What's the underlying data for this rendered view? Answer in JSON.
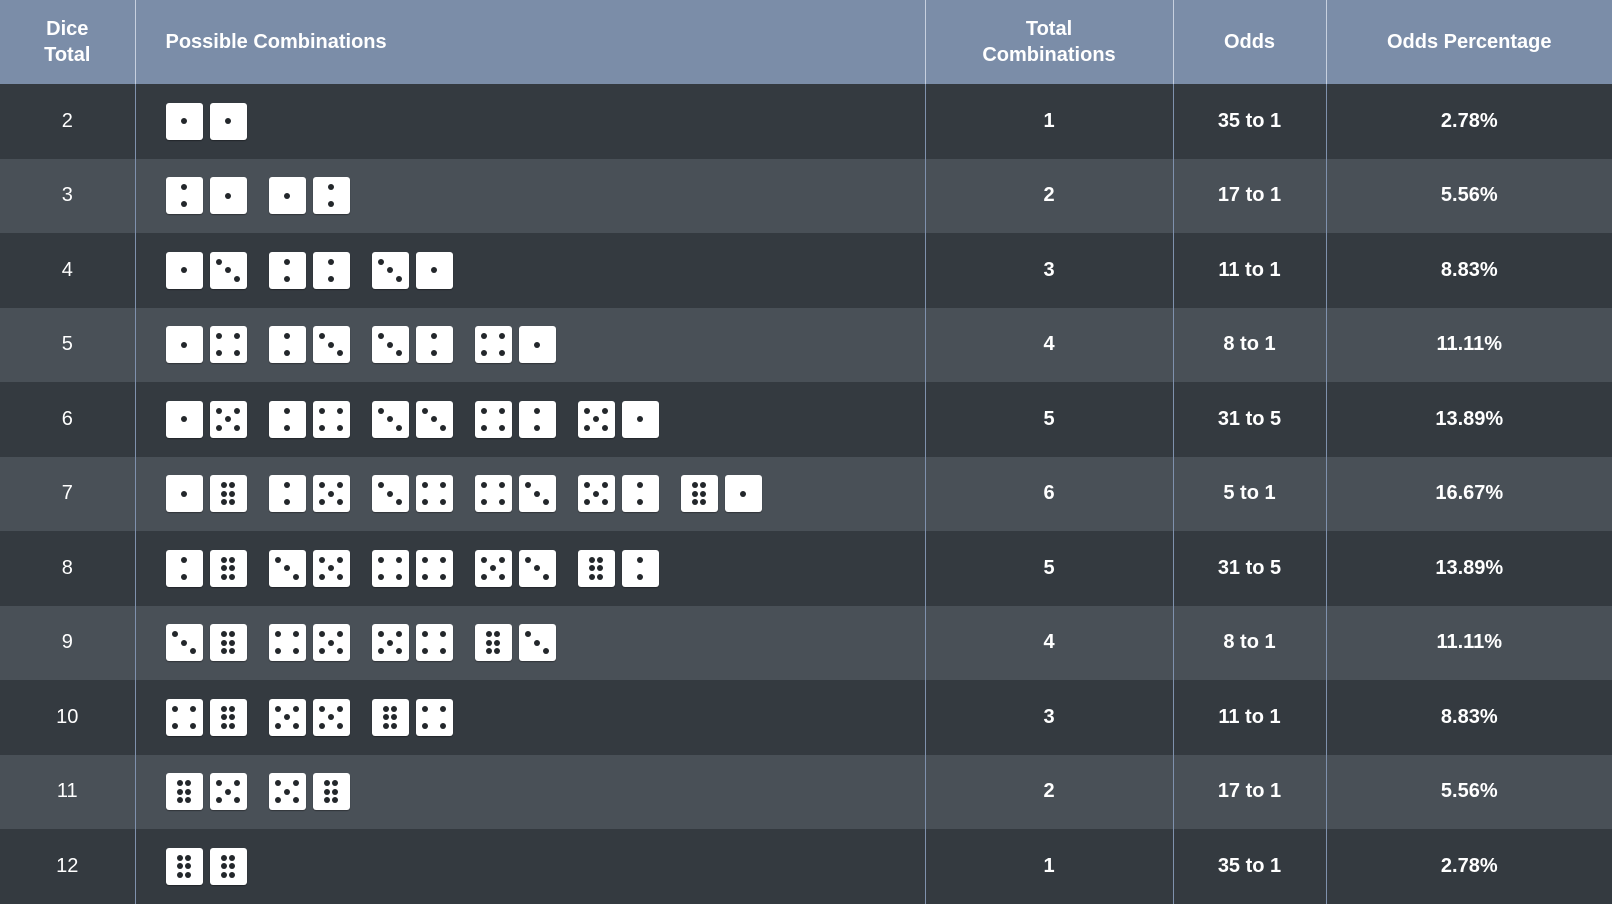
{
  "headers": {
    "dice_total": "Dice Total",
    "possible_combinations": "Possible Combinations",
    "total_combinations": "Total Combinations",
    "odds": "Odds",
    "odds_percentage": "Odds Percentage"
  },
  "rows": [
    {
      "total": "2",
      "combinations": [
        [
          1,
          1
        ]
      ],
      "count": "1",
      "odds": "35 to 1",
      "percentage": "2.78%"
    },
    {
      "total": "3",
      "combinations": [
        [
          2,
          1
        ],
        [
          1,
          2
        ]
      ],
      "count": "2",
      "odds": "17 to 1",
      "percentage": "5.56%"
    },
    {
      "total": "4",
      "combinations": [
        [
          1,
          3
        ],
        [
          2,
          2
        ],
        [
          3,
          1
        ]
      ],
      "count": "3",
      "odds": "11 to 1",
      "percentage": "8.83%"
    },
    {
      "total": "5",
      "combinations": [
        [
          1,
          4
        ],
        [
          2,
          3
        ],
        [
          3,
          2
        ],
        [
          4,
          1
        ]
      ],
      "count": "4",
      "odds": "8 to 1",
      "percentage": "11.11%"
    },
    {
      "total": "6",
      "combinations": [
        [
          1,
          5
        ],
        [
          2,
          4
        ],
        [
          3,
          3
        ],
        [
          4,
          2
        ],
        [
          5,
          1
        ]
      ],
      "count": "5",
      "odds": "31 to 5",
      "percentage": "13.89%"
    },
    {
      "total": "7",
      "combinations": [
        [
          1,
          6
        ],
        [
          2,
          5
        ],
        [
          3,
          4
        ],
        [
          4,
          3
        ],
        [
          5,
          2
        ],
        [
          6,
          1
        ]
      ],
      "count": "6",
      "odds": "5 to 1",
      "percentage": "16.67%"
    },
    {
      "total": "8",
      "combinations": [
        [
          2,
          6
        ],
        [
          3,
          5
        ],
        [
          4,
          4
        ],
        [
          5,
          3
        ],
        [
          6,
          2
        ]
      ],
      "count": "5",
      "odds": "31 to 5",
      "percentage": "13.89%"
    },
    {
      "total": "9",
      "combinations": [
        [
          3,
          6
        ],
        [
          4,
          5
        ],
        [
          5,
          4
        ],
        [
          6,
          3
        ]
      ],
      "count": "4",
      "odds": "8 to 1",
      "percentage": "11.11%"
    },
    {
      "total": "10",
      "combinations": [
        [
          4,
          6
        ],
        [
          5,
          5
        ],
        [
          6,
          4
        ]
      ],
      "count": "3",
      "odds": "11 to 1",
      "percentage": "8.83%"
    },
    {
      "total": "11",
      "combinations": [
        [
          6,
          5
        ],
        [
          5,
          6
        ]
      ],
      "count": "2",
      "odds": "17 to 1",
      "percentage": "5.56%"
    },
    {
      "total": "12",
      "combinations": [
        [
          6,
          6
        ]
      ],
      "count": "1",
      "odds": "35 to 1",
      "percentage": "2.78%"
    }
  ],
  "colors": {
    "header_bg": "#7b8da8",
    "row_dark": "#343a40",
    "row_light": "#495057",
    "die_face": "#ffffff",
    "pip": "#23272b"
  }
}
